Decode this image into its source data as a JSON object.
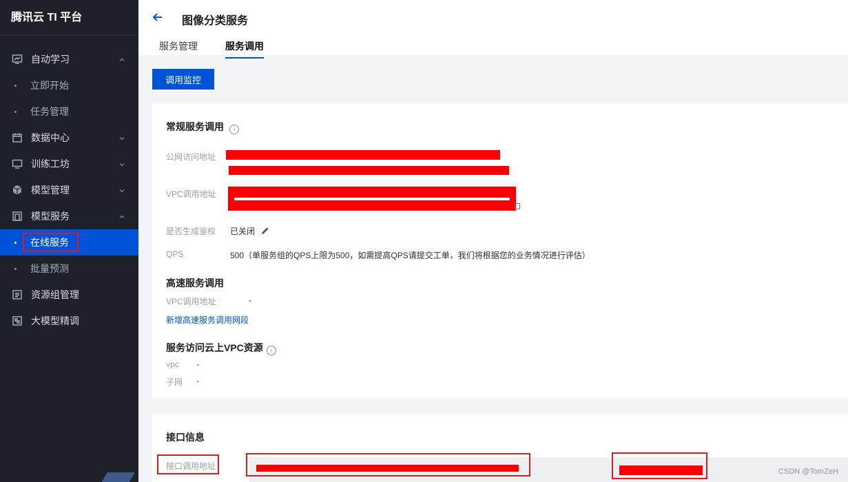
{
  "brand": "腾讯云 TI 平台",
  "sidebar": {
    "items": [
      {
        "label": "自动学习",
        "icon": "monitor-chart-icon",
        "chevron": "up"
      },
      {
        "label": "立即开始",
        "sub": true
      },
      {
        "label": "任务管理",
        "sub": true
      },
      {
        "label": "数据中心",
        "icon": "calendar-icon",
        "chevron": "down"
      },
      {
        "label": "训练工坊",
        "icon": "monitor-icon",
        "chevron": "down"
      },
      {
        "label": "模型管理",
        "icon": "cube-icon",
        "chevron": "down"
      },
      {
        "label": "模型服务",
        "icon": "copy-icon",
        "chevron": "up"
      },
      {
        "label": "在线服务",
        "sub": true,
        "active": true
      },
      {
        "label": "批量预测",
        "sub": true
      },
      {
        "label": "资源组管理",
        "icon": "list-icon"
      },
      {
        "label": "大模型精调",
        "icon": "tune-icon"
      }
    ]
  },
  "header": {
    "title": "图像分类服务",
    "tabs": [
      "服务管理",
      "服务调用"
    ],
    "active_tab": "服务调用"
  },
  "main": {
    "monitor_button": "调用监控",
    "regular": {
      "title": "常规服务调用",
      "public_label": "公网访问地址",
      "vpc_label": "VPC调用地址",
      "auth_label": "是否生成鉴权",
      "auth_value": "已关闭",
      "qps_label": "QPS",
      "qps_value": "500（单服务组的QPS上限为500，如需提高QPS请提交工单，我们将根据您的业务情况进行评估）"
    },
    "highspeed": {
      "title": "高速服务调用",
      "vpc_label": "VPC调用地址",
      "vpc_value": "-",
      "add_link": "新增高速服务调用网段"
    },
    "cloud_vpc": {
      "title": "服务访问云上VPC资源",
      "vpc_label": "vpc",
      "vpc_value": "-",
      "subnet_label": "子网",
      "subnet_value": "-"
    },
    "api": {
      "title": "接口信息",
      "endpoint_label": "接口调用地址"
    }
  },
  "watermark": "CSDN @TomZeH",
  "colors": {
    "accent": "#0052d9",
    "sidebar_bg": "#1e2228",
    "highlight_red": "#e0191b",
    "redaction": "#fb0000"
  }
}
